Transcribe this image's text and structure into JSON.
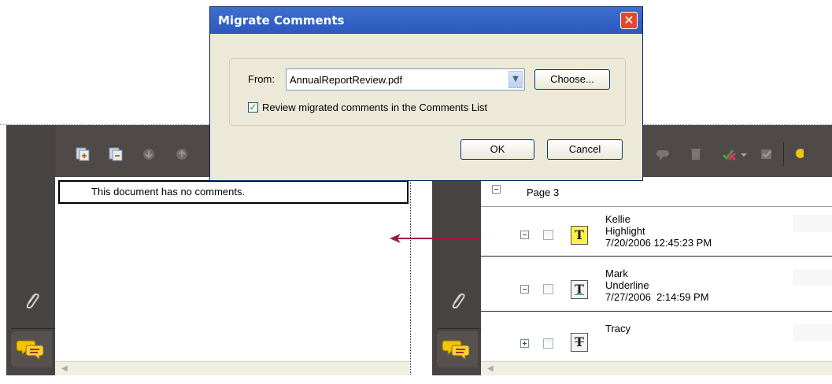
{
  "dialog": {
    "title": "Migrate Comments",
    "from_label": "From:",
    "from_value": "AnnualReportReview.pdf",
    "choose_label": "Choose...",
    "checkbox_label": "Review migrated comments in the Comments List",
    "checkbox_checked": true,
    "ok_label": "OK",
    "cancel_label": "Cancel"
  },
  "left_panel": {
    "empty_message": "This document has no comments."
  },
  "right_panel": {
    "page_label": "Page 3",
    "comments": [
      {
        "author": "Kellie",
        "type": "Highlight",
        "date": "7/20/2006 12:45:23 PM",
        "icon": "highlight-text-icon",
        "expanded": true
      },
      {
        "author": "Mark",
        "type": "Underline",
        "date": "7/27/2006  2:14:59 PM",
        "icon": "underline-text-icon",
        "expanded": true
      },
      {
        "author": "Tracy",
        "type": "",
        "date": "",
        "icon": "strikethrough-text-icon",
        "expanded": false
      }
    ]
  },
  "colors": {
    "arrow": "#9b1b46",
    "panel_bg": "#4a4645",
    "dialog_title": "#2c58bb"
  },
  "icons": [
    "attachment-icon",
    "comments-icon",
    "close-icon",
    "dropdown-arrow-icon"
  ]
}
